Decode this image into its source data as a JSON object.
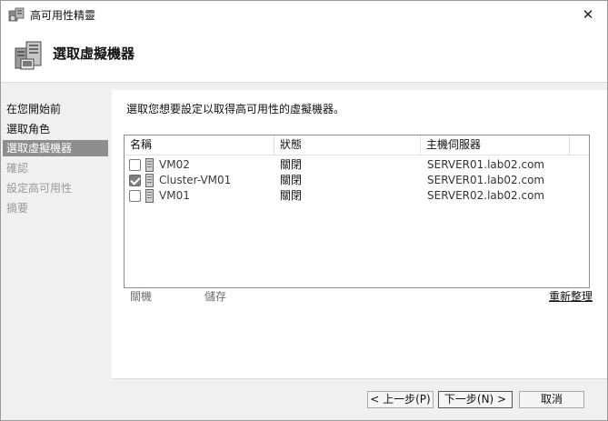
{
  "window": {
    "title": "高可用性精靈",
    "close_glyph": "✕"
  },
  "header": {
    "title": "選取虛擬機器"
  },
  "nav": {
    "items": [
      {
        "label": "在您開始前",
        "state": "normal"
      },
      {
        "label": "選取角色",
        "state": "normal"
      },
      {
        "label": "選取虛擬機器",
        "state": "active"
      },
      {
        "label": "確認",
        "state": "disabled"
      },
      {
        "label": "設定高可用性",
        "state": "disabled"
      },
      {
        "label": "摘要",
        "state": "disabled"
      }
    ]
  },
  "main": {
    "instruction": "選取您想要設定以取得高可用性的虛擬機器。",
    "columns": [
      "名稱",
      "狀態",
      "主機伺服器"
    ],
    "rows": [
      {
        "checked": false,
        "name": "VM02",
        "state": "關閉",
        "host": "SERVER01.lab02.com"
      },
      {
        "checked": true,
        "name": "Cluster-VM01",
        "state": "關閉",
        "host": "SERVER01.lab02.com"
      },
      {
        "checked": false,
        "name": "VM01",
        "state": "關閉",
        "host": "SERVER02.lab02.com"
      }
    ],
    "shutdown_label": "關機",
    "save_label": "儲存",
    "refresh_label": "重新整理"
  },
  "footer": {
    "prev_label": "< 上一步(P)",
    "next_label": "下一步(N) >",
    "cancel_label": "取消"
  },
  "colors": {
    "active_nav": "#8e8e8e",
    "panel_bg": "#f0f0f0"
  }
}
